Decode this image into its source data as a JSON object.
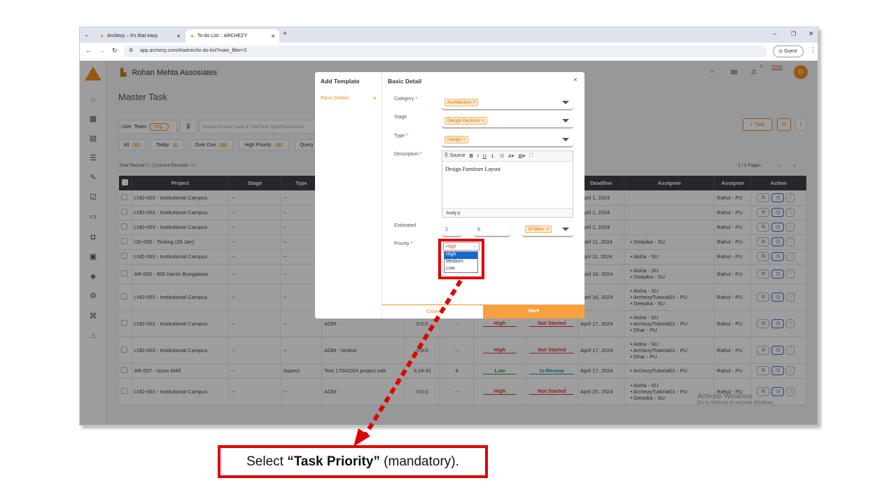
{
  "browser": {
    "tabs": [
      {
        "title": "Archezy – It's that easy"
      },
      {
        "title": "To-do List :: ARCHEZY"
      }
    ],
    "url": "app.archezy.com/#/admin/to-do-list?main_filter=2",
    "guest_label": "Guest"
  },
  "app": {
    "org_name": "Rohan Mehta Assosiates",
    "page_title": "Master Task",
    "notif_count": "0",
    "coin_count": "2050",
    "avatar_letter": "R",
    "toggle": {
      "user": "User",
      "team": "Team",
      "org": "Org."
    },
    "search_placeholder": "Search Project Code & Title/Task Type/Description",
    "filters": [
      {
        "label": "All",
        "count": "21"
      },
      {
        "label": "Today",
        "count": "3"
      },
      {
        "label": "Over Due",
        "count": "16"
      },
      {
        "label": "High Priority",
        "count": "19"
      },
      {
        "label": "Query"
      }
    ],
    "total_label": "Total Record:",
    "total": "21",
    "current_label": " | Current Records: ",
    "current": "20",
    "task_button": "Task",
    "pages": "1 / 2 Pages",
    "columns": [
      "Project",
      "Stage",
      "Type",
      "Deadline",
      "Assignee",
      "Assignor",
      "Action"
    ],
    "rows": [
      {
        "project": "LND-003 - Institutional Campus",
        "stage": "--",
        "type": "--",
        "deadline": "April 1, 2024",
        "assignee": [],
        "assignor": "Rahul - PU"
      },
      {
        "project": "LND-003 - Institutional Campus",
        "stage": "--",
        "type": "--",
        "deadline": "April 1, 2024",
        "assignee": [],
        "assignor": "Rahul - PU"
      },
      {
        "project": "LND-003 - Institutional Campus",
        "stage": "--",
        "type": "--",
        "deadline": "April 1, 2024",
        "assignee": [],
        "assignor": "Rahul - PU"
      },
      {
        "project": "UD-005 - Testing (26 Jan)",
        "stage": "--",
        "type": "--",
        "deadline": "April 11, 2024",
        "assignee": [
          "Deepika - SU"
        ],
        "assignor": "Rahul - PU"
      },
      {
        "project": "LND-003 - Institutional Campus",
        "stage": "--",
        "type": "--",
        "deadline": "April 11, 2024",
        "assignee": [
          "Aisha - SU"
        ],
        "assignor": "Rahul - PU"
      },
      {
        "project": "AR-005 - 900 Harsh Bungalows",
        "stage": "--",
        "type": "--",
        "deadline": "April 16, 2024",
        "assignee": [
          "Aisha - SU",
          "Deepika - SU"
        ],
        "assignor": "Rahul - PU"
      },
      {
        "project": "LND-003 - Institutional Campus",
        "stage": "--",
        "type": "--",
        "deadline": "April 16, 2024",
        "assignee": [
          "Aisha - SU",
          "ArchezyTutorial01 - PU",
          "Deepika - SU"
        ],
        "assignor": "Rahul - PU"
      },
      {
        "project": "LND-003 - Institutional Campus",
        "stage": "--",
        "type": "--",
        "desc": "AOM -",
        "time": "0:0:0",
        "est": "--",
        "priority": "High",
        "status": "Not Started",
        "deadline": "April 17, 2024",
        "assignee": [
          "Aisha - SU",
          "ArchezyTutorial01 - PU",
          "Dhar - PU"
        ],
        "assignor": "Rahul - PU"
      },
      {
        "project": "LND-003 - Institutional Campus",
        "stage": "--",
        "type": "--",
        "desc": "AOM - Nndnd",
        "time": "0:0:0",
        "est": "--",
        "priority": "High",
        "status": "Not Started",
        "deadline": "April 17, 2024",
        "assignee": [
          "Aisha - SU",
          "ArchezyTutorial01 - PU",
          "Dhar - PU"
        ],
        "assignor": "Rahul - PU"
      },
      {
        "project": "AR-007 - Iscon MAll",
        "stage": "--",
        "type": "Aspect",
        "desc": "Test 17042024 project edit",
        "time": "3:24:41",
        "est": "8",
        "priority": "Low",
        "status": "In-Review",
        "deadline": "April 17, 2024",
        "assignee": [
          "ArchezyTutorial01 - PU"
        ],
        "assignor": "Rahul - PU"
      },
      {
        "project": "LND-003 - Institutional Campus",
        "stage": "--",
        "type": "--",
        "desc": "AOM -",
        "time": "0:0:0",
        "est": "--",
        "priority": "High",
        "status": "Not Started",
        "deadline": "April 20, 2024",
        "assignee": [
          "Aisha - SU",
          "ArchezyTutorial01 - PU",
          "Deepika - SU"
        ],
        "assignor": "Rahul - PU"
      }
    ]
  },
  "modal": {
    "left_title": "Add Template",
    "left_item": "Basic Details",
    "title": "Basic Detail",
    "labels": {
      "category": "Category",
      "stage": "Stage",
      "type": "Type",
      "description": "Description",
      "estimated": "Estimated",
      "priority": "Priority"
    },
    "category": "Architecture",
    "stage": "Design Decision",
    "type": "Design",
    "toolbar": {
      "source": "Source"
    },
    "description": "Design Furniture Layout",
    "statusbar": "body  p",
    "est_h": "2",
    "est_m": "5",
    "est_unit": "10 Mins.",
    "priority_selected": "High",
    "priority_options": [
      "High",
      "Medium",
      "Low"
    ],
    "close": "Close",
    "save": "Save"
  },
  "watermark": {
    "line1": "Activate Windows",
    "line2": "Go to Settings to activate Windows."
  },
  "annotation": {
    "pre": "Select ",
    "bold": "“Task Priority”",
    "post": " (mandatory)."
  }
}
